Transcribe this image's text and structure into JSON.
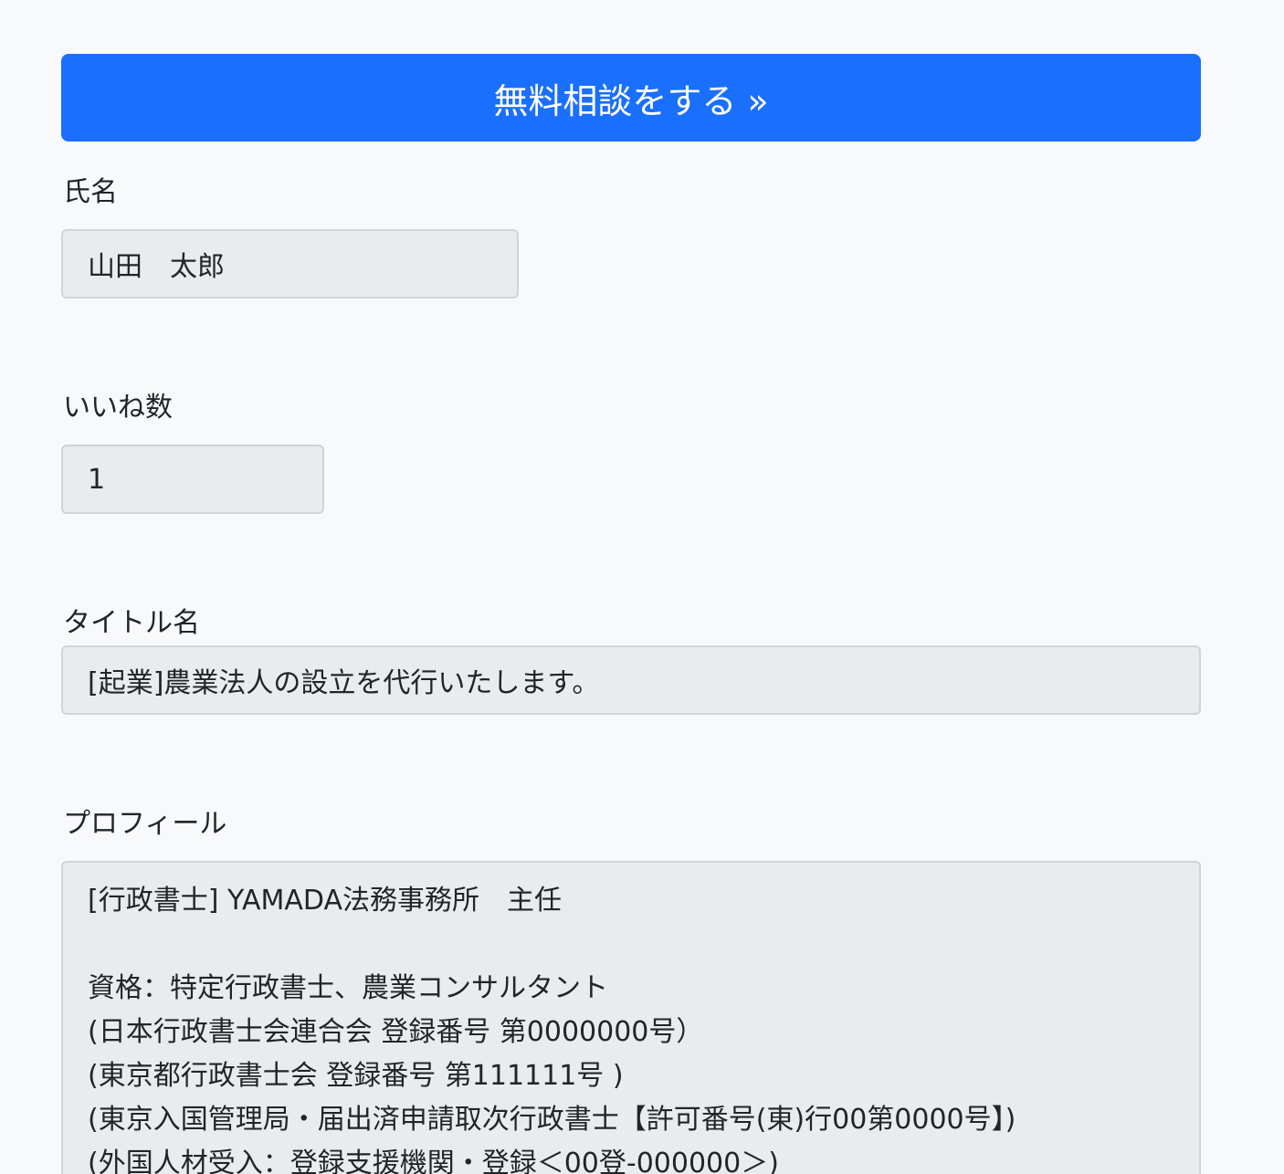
{
  "cta": {
    "label": "無料相談をする »"
  },
  "fields": {
    "name": {
      "label": "氏名",
      "value": "山田　太郎"
    },
    "likes": {
      "label": "いいね数",
      "value": "1"
    },
    "title": {
      "label": "タイトル名",
      "value": "[起業]農業法人の設立を代行いたします。"
    },
    "profile": {
      "label": "プロフィール",
      "lines": [
        "[行政書士] YAMADA法務事務所　主任",
        "",
        "資格：特定行政書士、農業コンサルタント",
        "(日本行政書士会連合会 登録番号 第0000000号）",
        "(東京都行政書士会 登録番号 第111111号 )",
        "(東京入国管理局・届出済申請取次行政書士【許可番号(東)行00第0000号】)",
        "(外国人材受入：登録支援機関・登録＜00登-000000＞)"
      ]
    }
  },
  "colors": {
    "page_background": "#f8f9fa",
    "cta_background": "#1a6ffd",
    "field_background": "#e9ecef",
    "field_border": "#ced4da"
  }
}
